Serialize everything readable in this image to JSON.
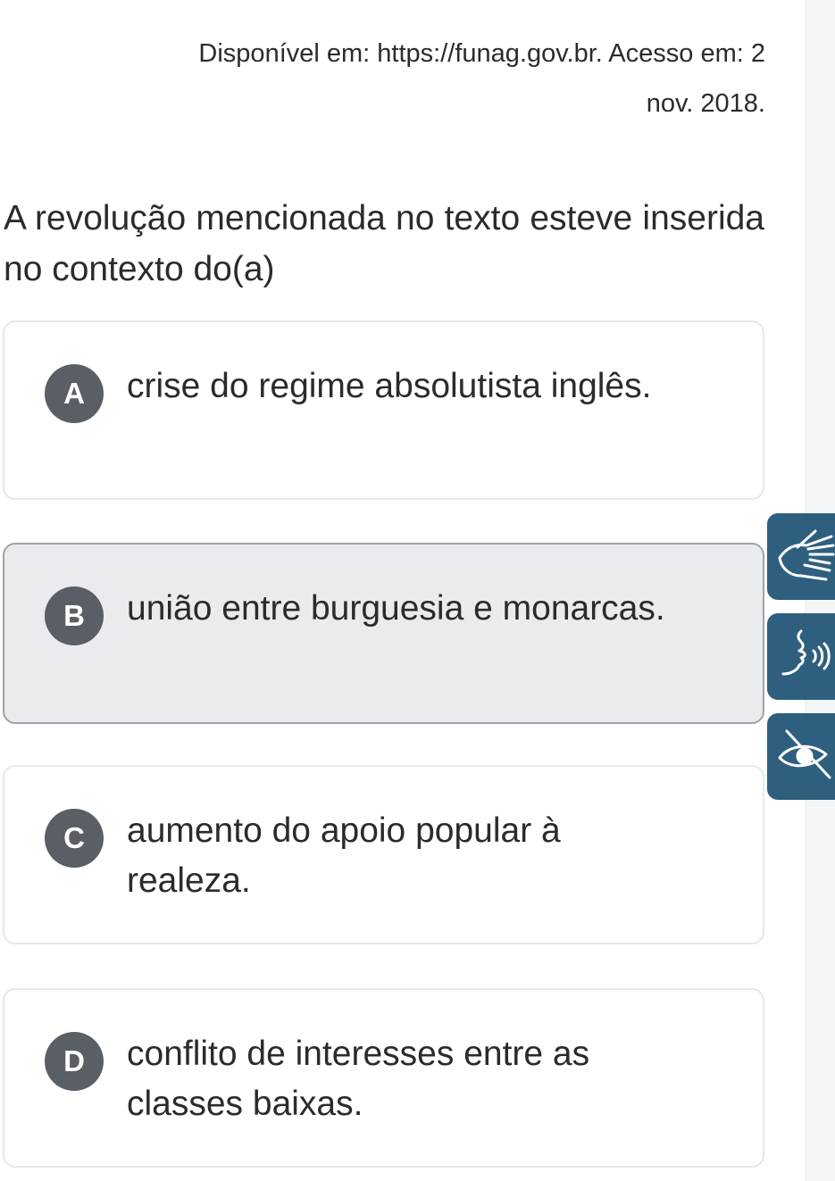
{
  "source": {
    "line1": "Disponível em: https://funag.gov.br. Acesso em: 2",
    "line2": "nov. 2018."
  },
  "question": {
    "text": "A revolução mencionada no texto esteve inserida no contexto do(a)"
  },
  "options": [
    {
      "letter": "A",
      "text": "crise do regime absolutista inglês.",
      "selected": false
    },
    {
      "letter": "B",
      "text": "união entre burguesia e monarcas.",
      "selected": true
    },
    {
      "letter": "C",
      "text": "aumento do apoio popular à realeza.",
      "selected": false
    },
    {
      "letter": "D",
      "text": "conflito de interesses entre as classes baixas.",
      "selected": false
    }
  ],
  "accessibility_buttons": [
    {
      "icon": "sign-language-hands-icon"
    },
    {
      "icon": "speaking-head-audio-icon"
    },
    {
      "icon": "eye-low-vision-icon"
    }
  ],
  "colors": {
    "letter_badge": "#5a5f66",
    "selected_option_bg": "#e9ebef",
    "accessibility_button": "#2f5f7f"
  }
}
